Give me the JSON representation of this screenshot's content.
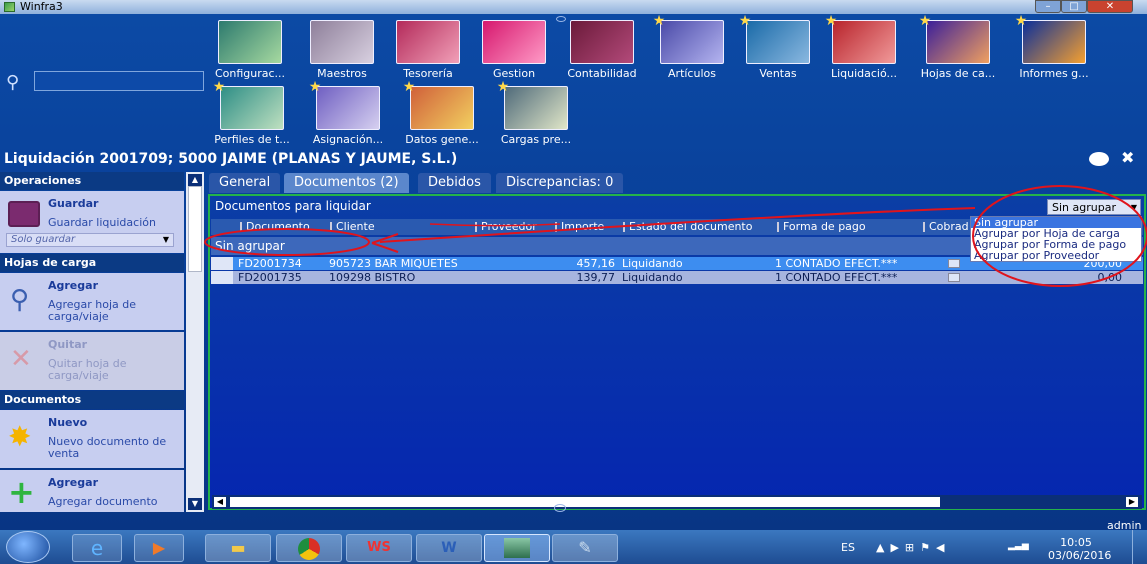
{
  "window": {
    "title": "Winfra3"
  },
  "tiles": [
    {
      "label": "Configurac...",
      "starred": false
    },
    {
      "label": "Maestros",
      "starred": false
    },
    {
      "label": "Tesorería",
      "starred": false
    },
    {
      "label": "Gestion",
      "starred": false
    },
    {
      "label": "Contabilidad",
      "starred": false
    },
    {
      "label": "Artículos",
      "starred": true
    },
    {
      "label": "Ventas",
      "starred": true
    },
    {
      "label": "Liquidació...",
      "starred": true
    },
    {
      "label": "Hojas de ca...",
      "starred": true
    },
    {
      "label": "Informes g...",
      "starred": true
    },
    {
      "label": "Perfiles de t...",
      "starred": true
    },
    {
      "label": "Asignación...",
      "starred": true
    },
    {
      "label": "Datos gene...",
      "starred": true
    },
    {
      "label": "Cargas pre...",
      "starred": true
    }
  ],
  "page": {
    "title": "Liquidación 2001709; 5000 JAIME (PLANAS Y JAUME, S.L.)"
  },
  "sidebar": {
    "operaciones": {
      "header": "Operaciones",
      "guardar_title": "Guardar",
      "guardar_sub": "Guardar liquidación",
      "select_placeholder": "Solo guardar"
    },
    "hojas": {
      "header": "Hojas de carga",
      "agregar_title": "Agregar",
      "agregar_sub": "Agregar hoja de carga/viaje",
      "quitar_title": "Quitar",
      "quitar_sub": "Quitar hoja de carga/viaje"
    },
    "documentos": {
      "header": "Documentos",
      "nuevo_title": "Nuevo",
      "nuevo_sub": "Nuevo documento de venta",
      "agregar_title": "Agregar",
      "agregar_sub": "Agregar documento"
    }
  },
  "tabs": [
    "General",
    "Documentos (2)",
    "Debidos",
    "Discrepancias: 0"
  ],
  "panel": {
    "title": "Documentos para liquidar",
    "group_select": "Sin agrupar",
    "group_options": [
      "Sin agrupar",
      "Agrupar por Hoja de carga",
      "Agrupar por Forma de pago",
      "Agrupar por Proveedor"
    ],
    "group_row": "Sin agrupar",
    "columns": [
      "Documento",
      "Cliente",
      "Proveedor",
      "Importe",
      "Estado del documento",
      "Forma de pago",
      "Cobrad"
    ],
    "rows": [
      {
        "documento": "FD2001734",
        "cliente": "905723 BAR MIQUETES",
        "importe": "457,16",
        "estado": "Liquidando",
        "forma": "1 CONTADO EFECT.***",
        "cobrado": "200,00"
      },
      {
        "documento": "FD2001735",
        "cliente": "109298 BISTRO",
        "importe": "139,77",
        "estado": "Liquidando",
        "forma": "1 CONTADO EFECT.***",
        "cobrado": "0,00"
      }
    ]
  },
  "statusbar": {
    "user": "admin"
  },
  "taskbar": {
    "lang": "ES",
    "time": "10:05",
    "date": "03/06/2016"
  },
  "colors": {
    "accent": "#0b3ea5",
    "highlight_row": "#3d8df0",
    "annotation": "#e0141c",
    "panel_border": "#25b24a"
  }
}
